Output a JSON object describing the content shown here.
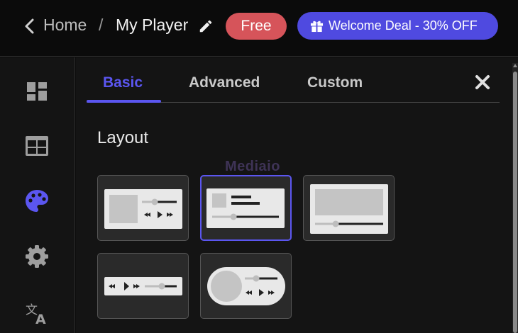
{
  "header": {
    "home_label": "Home",
    "separator": "/",
    "title": "My Player",
    "plan_badge": "Free",
    "deal_label": "Welcome Deal - 30% OFF",
    "back_icon": "chevron-left-icon",
    "edit_icon": "pencil-icon",
    "gift_icon": "gift-icon"
  },
  "sidebar": {
    "items": [
      {
        "icon": "dashboard-icon",
        "active": false
      },
      {
        "icon": "table-icon",
        "active": false
      },
      {
        "icon": "palette-icon",
        "active": true
      },
      {
        "icon": "gear-icon",
        "active": false
      },
      {
        "icon": "translate-icon",
        "active": false
      }
    ]
  },
  "panel": {
    "tabs": [
      {
        "label": "Basic",
        "active": true
      },
      {
        "label": "Advanced",
        "active": false
      },
      {
        "label": "Custom",
        "active": false
      }
    ],
    "section_title": "Layout",
    "watermark": "Mediaio",
    "layouts": [
      {
        "id": "layout-1",
        "selected": false
      },
      {
        "id": "layout-2",
        "selected": true
      },
      {
        "id": "layout-3",
        "selected": false
      },
      {
        "id": "layout-4",
        "selected": false
      },
      {
        "id": "layout-5",
        "selected": false
      }
    ]
  },
  "colors": {
    "accent": "#5b56f0",
    "free_badge": "#d6545a",
    "deal_button": "#4f4ae0",
    "background": "#0b0b0b",
    "panel": "#141414"
  }
}
